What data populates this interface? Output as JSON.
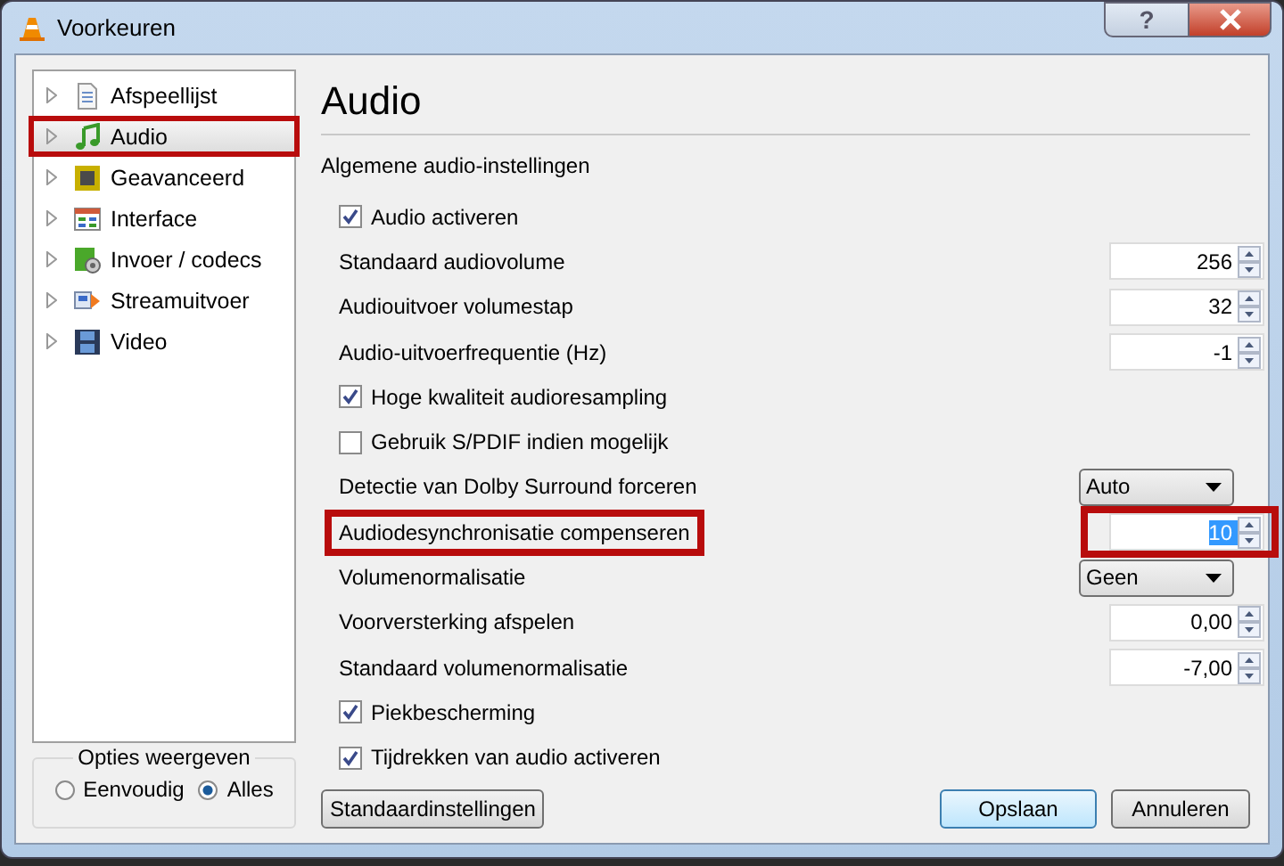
{
  "window": {
    "title": "Voorkeuren",
    "help": "?"
  },
  "tree": [
    {
      "label": "Afspeellijst",
      "kind": "playlist",
      "selected": false,
      "highlighted": false
    },
    {
      "label": "Audio",
      "kind": "audio",
      "selected": true,
      "highlighted": true
    },
    {
      "label": "Geavanceerd",
      "kind": "advanced",
      "selected": false,
      "highlighted": false
    },
    {
      "label": "Interface",
      "kind": "interface",
      "selected": false,
      "highlighted": false
    },
    {
      "label": "Invoer / codecs",
      "kind": "codecs",
      "selected": false,
      "highlighted": false
    },
    {
      "label": "Streamuitvoer",
      "kind": "stream",
      "selected": false,
      "highlighted": false
    },
    {
      "label": "Video",
      "kind": "video",
      "selected": false,
      "highlighted": false
    }
  ],
  "view_options": {
    "title": "Opties weergeven",
    "options": [
      {
        "label": "Eenvoudig",
        "selected": false
      },
      {
        "label": "Alles",
        "selected": true
      }
    ]
  },
  "panel": {
    "title": "Audio",
    "subtitle": "Algemene audio-instellingen",
    "settings": [
      {
        "kind": "checkbox",
        "label": "Audio activeren",
        "checked": true
      },
      {
        "kind": "spin",
        "label": "Standaard audiovolume",
        "value": "256"
      },
      {
        "kind": "spin",
        "label": "Audiouitvoer volumestap",
        "value": "32"
      },
      {
        "kind": "spin",
        "label": "Audio-uitvoerfrequentie (Hz)",
        "value": "-1"
      },
      {
        "kind": "checkbox",
        "label": "Hoge kwaliteit audioresampling",
        "checked": true
      },
      {
        "kind": "checkbox",
        "label": "Gebruik S/PDIF indien mogelijk",
        "checked": false
      },
      {
        "kind": "select",
        "label": "Detectie van Dolby Surround forceren",
        "value": "Auto"
      },
      {
        "kind": "spin",
        "label": "Audiodesynchronisatie compenseren",
        "value": "10",
        "highlighted": true,
        "text_selected": true
      },
      {
        "kind": "select",
        "label": "Volumenormalisatie",
        "value": "Geen"
      },
      {
        "kind": "spin",
        "label": "Voorversterking afspelen",
        "value": "0,00"
      },
      {
        "kind": "spin",
        "label": "Standaard volumenormalisatie",
        "value": "-7,00"
      },
      {
        "kind": "checkbox",
        "label": "Piekbescherming",
        "checked": true
      },
      {
        "kind": "checkbox",
        "label": "Tijdrekken van audio activeren",
        "checked": true
      }
    ]
  },
  "buttons": {
    "reset": "Standaardinstellingen",
    "save": "Opslaan",
    "cancel": "Annuleren"
  }
}
